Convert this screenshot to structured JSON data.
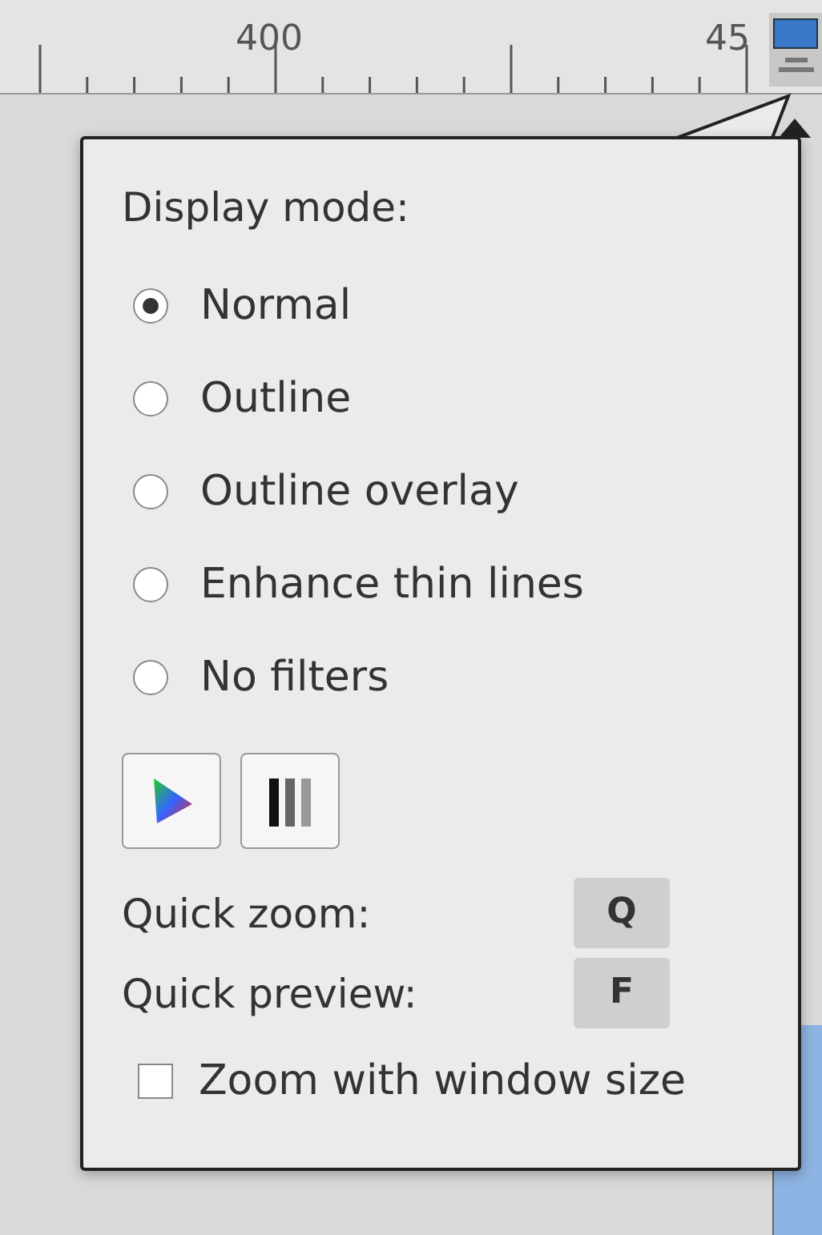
{
  "ruler": {
    "labels": [
      "400",
      "45"
    ]
  },
  "popup": {
    "title": "Display mode:",
    "modes": [
      {
        "label": "Normal",
        "selected": true
      },
      {
        "label": "Outline",
        "selected": false
      },
      {
        "label": "Outline overlay",
        "selected": false
      },
      {
        "label": "Enhance thin lines",
        "selected": false
      },
      {
        "label": "No filters",
        "selected": false
      }
    ],
    "shortcuts": [
      {
        "label": "Quick zoom:",
        "key": "Q"
      },
      {
        "label": "Quick preview:",
        "key": "F"
      }
    ],
    "zoom_with_window": {
      "label": "Zoom with window size",
      "checked": false
    }
  }
}
